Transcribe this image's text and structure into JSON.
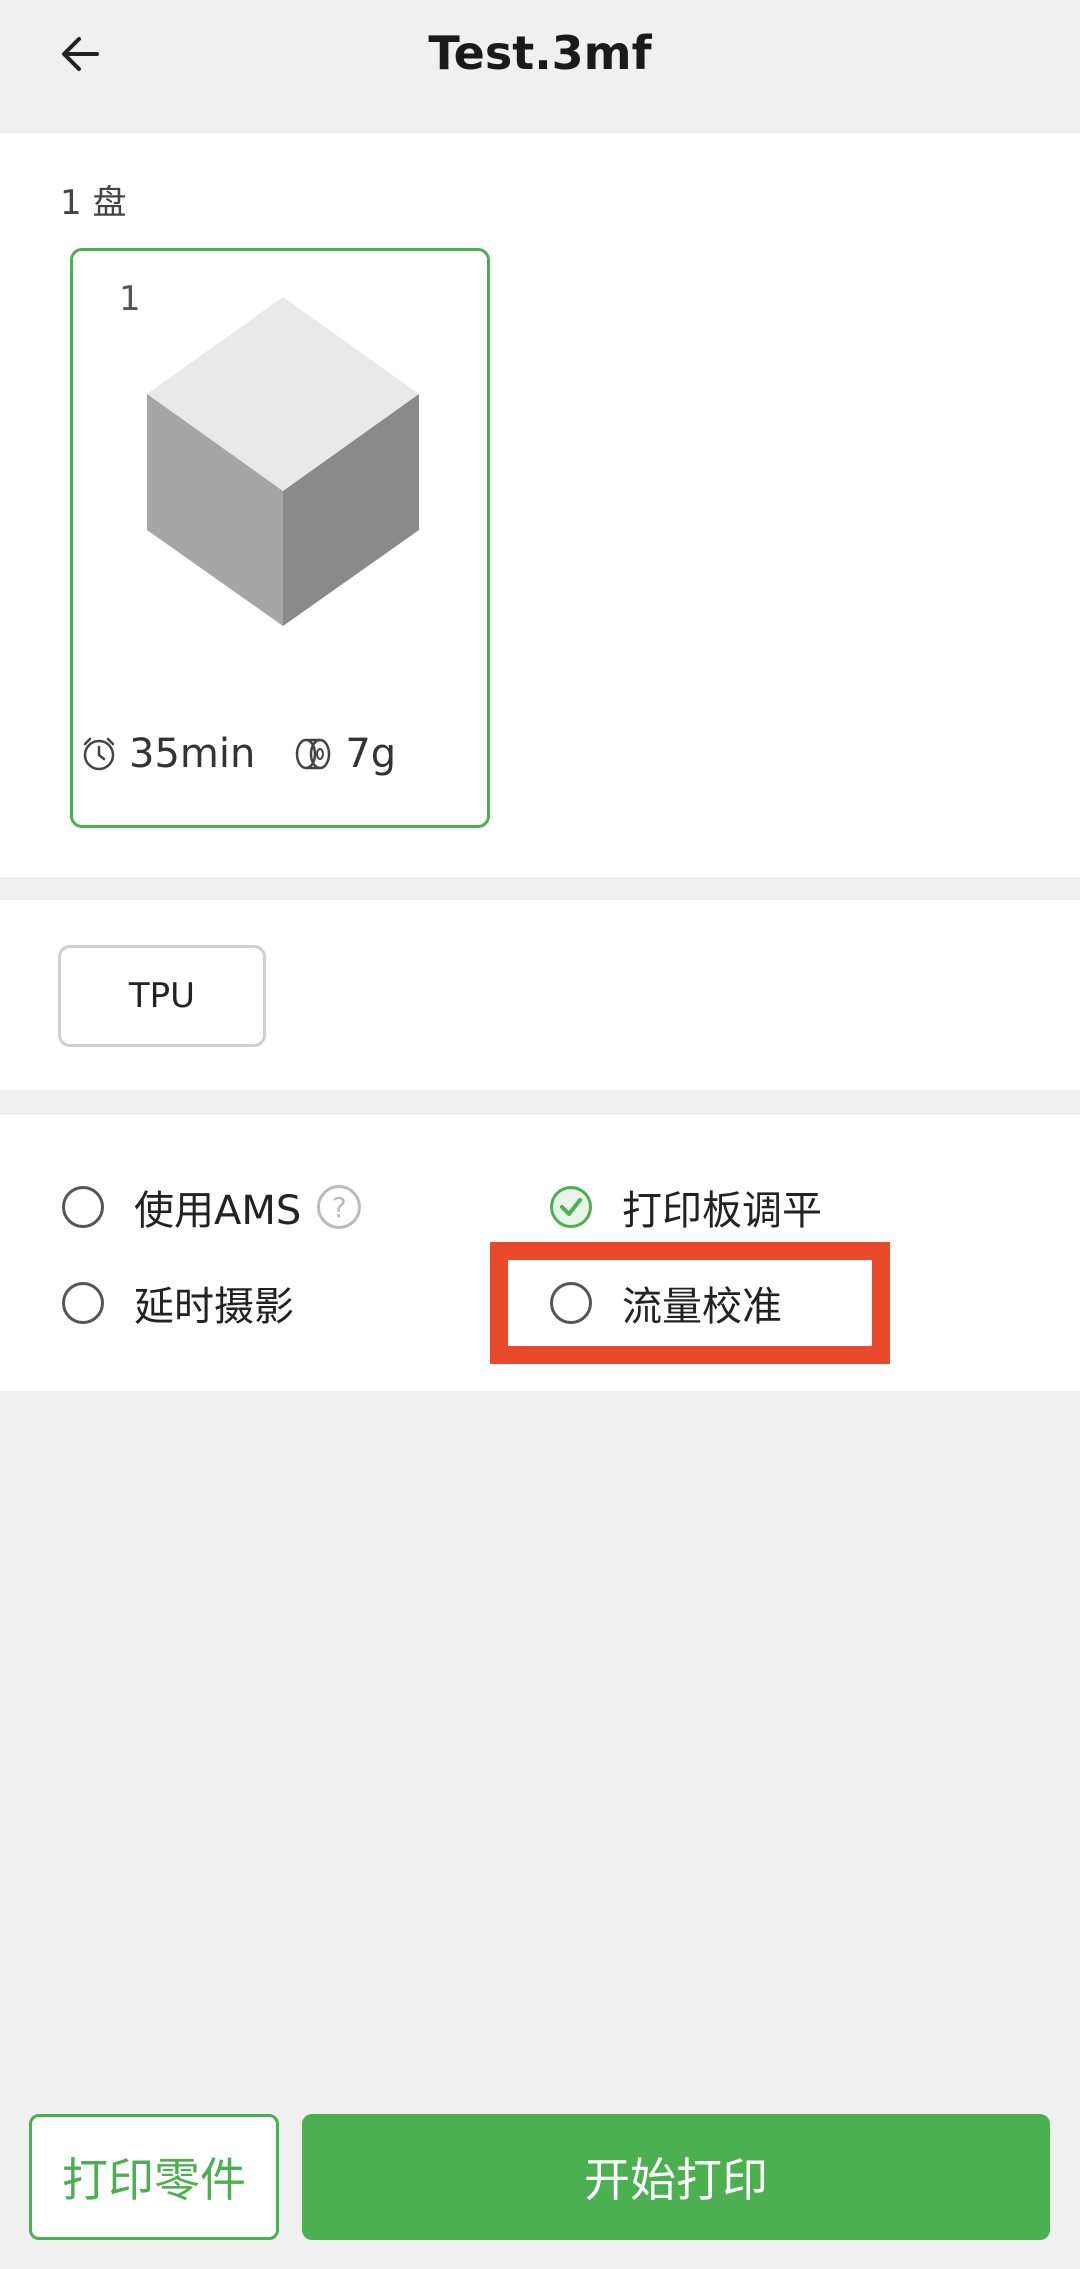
{
  "header": {
    "title": "Test.3mf"
  },
  "plates": {
    "count_label": "1 盘",
    "items": [
      {
        "index": "1",
        "time": "35min",
        "weight": "7g"
      }
    ]
  },
  "filaments": [
    {
      "label": "TPU"
    }
  ],
  "options": {
    "use_ams": {
      "label": "使用AMS",
      "checked": false
    },
    "bed_leveling": {
      "label": "打印板调平",
      "checked": true
    },
    "timelapse": {
      "label": "延时摄影",
      "checked": false
    },
    "flow_calibration": {
      "label": "流量校准",
      "checked": false
    }
  },
  "footer": {
    "print_parts_label": "打印零件",
    "start_label": "开始打印"
  },
  "colors": {
    "accent": "#4caf50",
    "highlight": "#e84a2b"
  },
  "icons": [
    "back-arrow-icon",
    "clock-icon",
    "filament-spool-icon",
    "help-icon",
    "checkmark-icon"
  ]
}
